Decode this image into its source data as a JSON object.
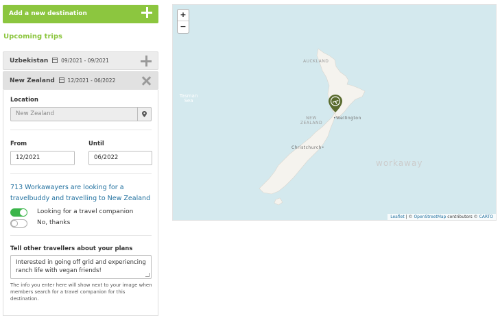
{
  "add_destination": {
    "label": "Add a new destination"
  },
  "upcoming_heading": "Upcoming trips",
  "trips": [
    {
      "country": "Uzbekistan",
      "dates": "09/2021 - 09/2021",
      "state": "collapsed"
    },
    {
      "country": "New Zealand",
      "dates": "12/2021 - 06/2022",
      "state": "expanded"
    }
  ],
  "form": {
    "location_label": "Location",
    "location_value": "New Zealand",
    "from_label": "From",
    "from_value": "12/2021",
    "until_label": "Until",
    "until_value": "06/2022",
    "info_text": "713 Workawayers are looking for a travelbuddy and travelling to New Zealand",
    "toggle_yes_label": "Looking for a travel companion",
    "toggle_no_label": "No, thanks",
    "plans_label": "Tell other travellers about your plans",
    "plans_value": "Interested in going off grid and experiencing ranch life with vegan friends!",
    "help_text": "The info you enter here will show next to your image when members search for a travel companion for this destination."
  },
  "map": {
    "zoom_in": "+",
    "zoom_out": "−",
    "labels": {
      "auckland": "AUCKLAND",
      "new_zealand": "NEW ZEALAND",
      "wellington": "•Wellington",
      "christchurch": "Christchurch•",
      "tasman_sea": "Tasman Sea"
    },
    "watermark": "workaway",
    "attribution": {
      "leaflet": "Leaflet",
      "sep1": " | © ",
      "osm": "OpenStreetMap",
      "mid": " contributors © ",
      "carto": "CARTO"
    }
  },
  "colors": {
    "brand_green": "#8cc63f",
    "toggle_on": "#3bb54a",
    "link_blue": "#1f6f9e",
    "map_water": "#d4e9ee",
    "pin": "#5a6b2e"
  },
  "icons": [
    "plus-icon",
    "calendar-icon",
    "close-icon",
    "map-pin-icon",
    "airplane-pin-icon"
  ]
}
